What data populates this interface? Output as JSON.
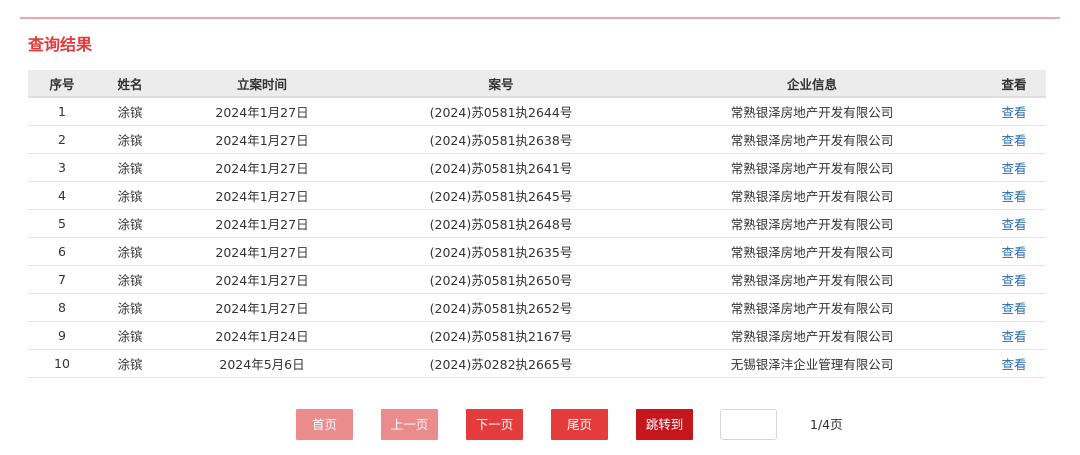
{
  "section": {
    "title": "查询结果"
  },
  "table": {
    "headers": {
      "index": "序号",
      "name": "姓名",
      "date": "立案时间",
      "case_no": "案号",
      "company": "企业信息",
      "view": "查看"
    },
    "rows": [
      {
        "index": "1",
        "name": "涂镔",
        "date": "2024年1月27日",
        "case_no": "(2024)苏0581执2644号",
        "company": "常熟银泽房地产开发有限公司",
        "view": "查看"
      },
      {
        "index": "2",
        "name": "涂镔",
        "date": "2024年1月27日",
        "case_no": "(2024)苏0581执2638号",
        "company": "常熟银泽房地产开发有限公司",
        "view": "查看"
      },
      {
        "index": "3",
        "name": "涂镔",
        "date": "2024年1月27日",
        "case_no": "(2024)苏0581执2641号",
        "company": "常熟银泽房地产开发有限公司",
        "view": "查看"
      },
      {
        "index": "4",
        "name": "涂镔",
        "date": "2024年1月27日",
        "case_no": "(2024)苏0581执2645号",
        "company": "常熟银泽房地产开发有限公司",
        "view": "查看"
      },
      {
        "index": "5",
        "name": "涂镔",
        "date": "2024年1月27日",
        "case_no": "(2024)苏0581执2648号",
        "company": "常熟银泽房地产开发有限公司",
        "view": "查看"
      },
      {
        "index": "6",
        "name": "涂镔",
        "date": "2024年1月27日",
        "case_no": "(2024)苏0581执2635号",
        "company": "常熟银泽房地产开发有限公司",
        "view": "查看"
      },
      {
        "index": "7",
        "name": "涂镔",
        "date": "2024年1月27日",
        "case_no": "(2024)苏0581执2650号",
        "company": "常熟银泽房地产开发有限公司",
        "view": "查看"
      },
      {
        "index": "8",
        "name": "涂镔",
        "date": "2024年1月27日",
        "case_no": "(2024)苏0581执2652号",
        "company": "常熟银泽房地产开发有限公司",
        "view": "查看"
      },
      {
        "index": "9",
        "name": "涂镔",
        "date": "2024年1月24日",
        "case_no": "(2024)苏0581执2167号",
        "company": "常熟银泽房地产开发有限公司",
        "view": "查看"
      },
      {
        "index": "10",
        "name": "涂镔",
        "date": "2024年5月6日",
        "case_no": "(2024)苏0282执2665号",
        "company": "无锡银泽沣企业管理有限公司",
        "view": "查看"
      }
    ]
  },
  "pagination": {
    "first": "首页",
    "prev": "上一页",
    "next": "下一页",
    "last": "尾页",
    "jump": "跳转到",
    "jump_input_value": "",
    "page_info": "1/4页"
  },
  "colors": {
    "title": "#e23a3a",
    "link": "#2a6db5",
    "pager_disabled": "#ec8b8b",
    "pager_active": "#e43c3c",
    "pager_jump": "#c4161c"
  }
}
